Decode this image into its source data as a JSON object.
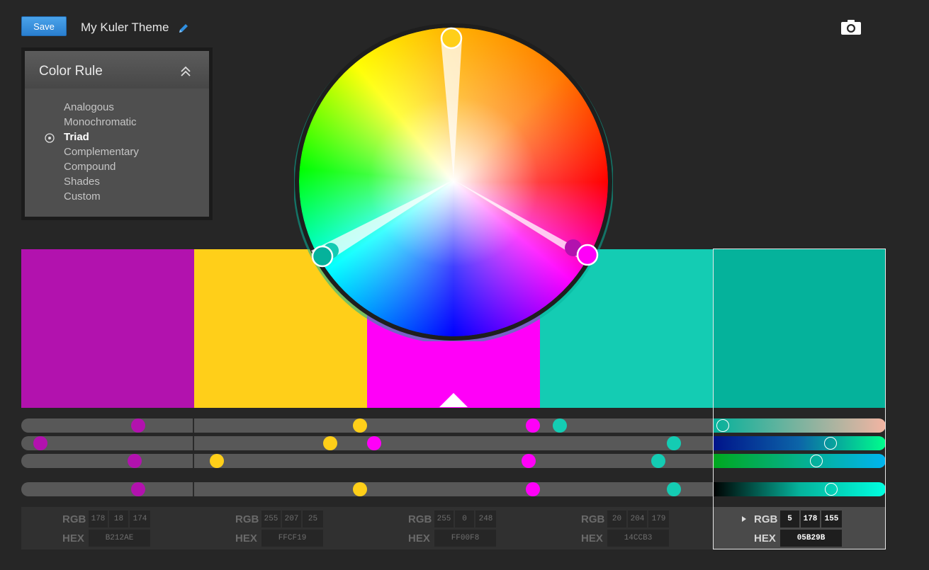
{
  "toolbar": {
    "save_label": "Save",
    "theme_title": "My Kuler Theme"
  },
  "icons": {
    "edit": "pencil-icon",
    "capture": "camera-icon",
    "collapse": "double-chevron-up-icon",
    "radio": "radio-selected-icon"
  },
  "color_rule": {
    "title": "Color Rule",
    "options": [
      "Analogous",
      "Monochromatic",
      "Triad",
      "Complementary",
      "Compound",
      "Shades",
      "Custom"
    ],
    "selected": "Triad"
  },
  "swatches": [
    {
      "hex_color": "#B212AE",
      "rgb": [
        "178",
        "18",
        "174"
      ],
      "hex": "B212AE"
    },
    {
      "hex_color": "#FFCF19",
      "rgb": [
        "255",
        "207",
        "25"
      ],
      "hex": "FFCF19"
    },
    {
      "hex_color": "#FF00F8",
      "rgb": [
        "255",
        "0",
        "248"
      ],
      "hex": "FF00F8"
    },
    {
      "hex_color": "#14CCB3",
      "rgb": [
        "20",
        "204",
        "179"
      ],
      "hex": "14CCB3"
    },
    {
      "hex_color": "#05B29B",
      "rgb": [
        "5",
        "178",
        "155"
      ],
      "hex": "05B29B"
    }
  ],
  "selected_swatch": 4,
  "labels": {
    "rgb": "RGB",
    "hex": "HEX"
  }
}
